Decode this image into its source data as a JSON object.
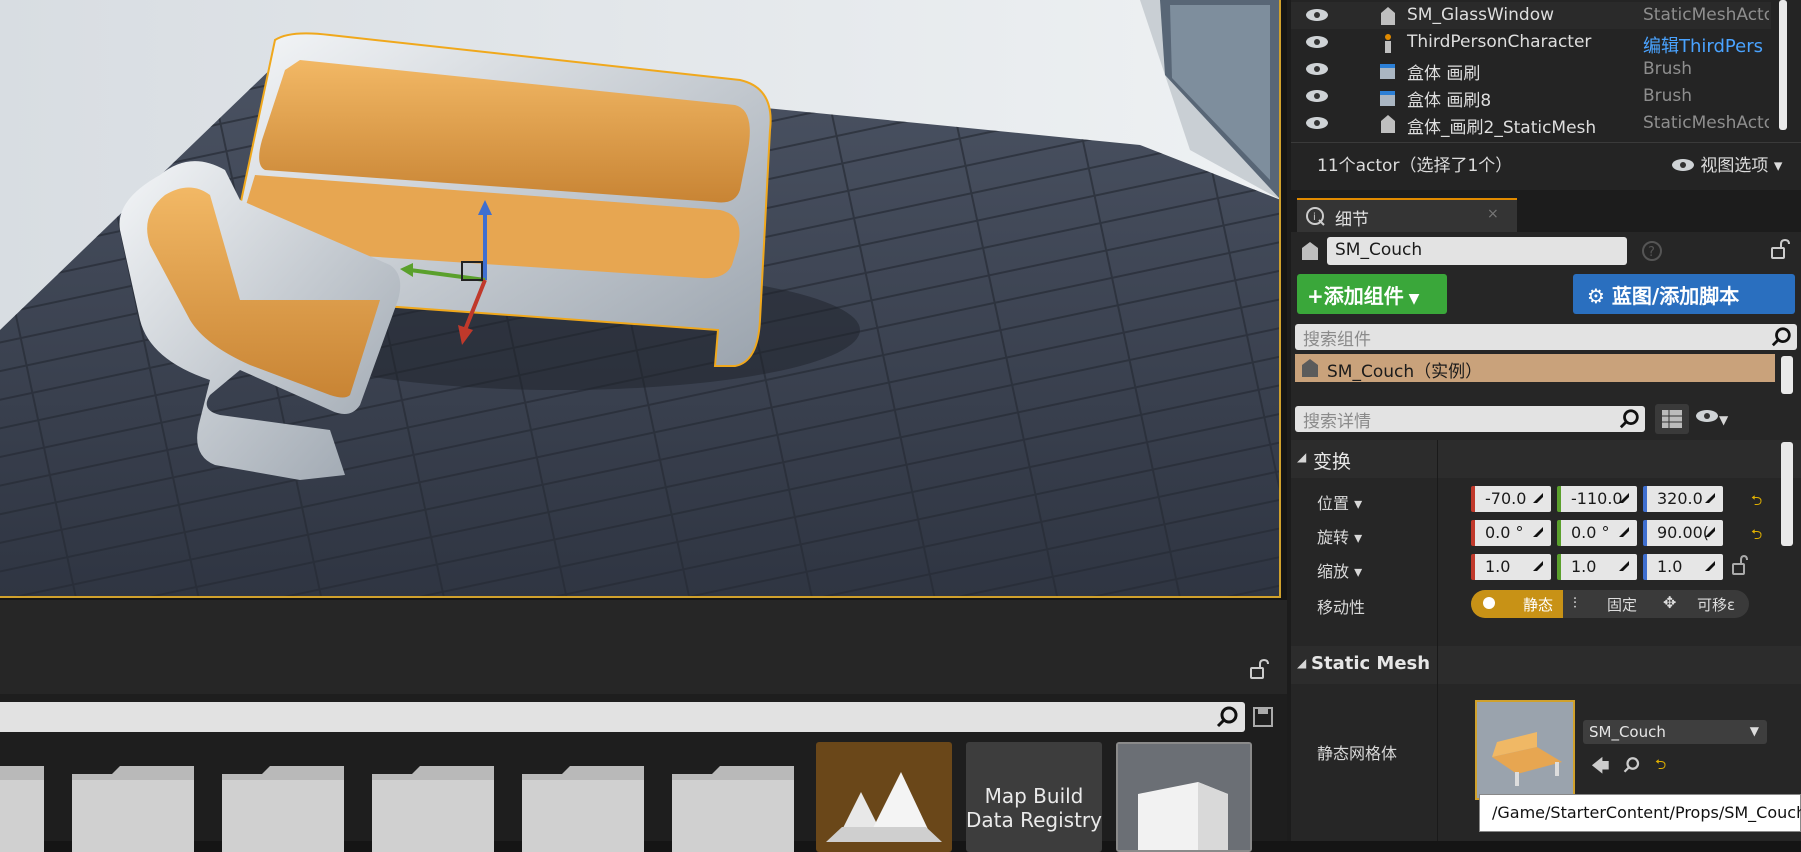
{
  "outliner": {
    "rows": [
      {
        "name": "SM_GlassWindow",
        "type": "StaticMeshActo"
      },
      {
        "name": "ThirdPersonCharacter",
        "type": "编辑ThirdPers"
      },
      {
        "name": "盒体 画刷",
        "type": "Brush"
      },
      {
        "name": "盒体 画刷8",
        "type": "Brush"
      },
      {
        "name": "盒体_画刷2_StaticMesh",
        "type": "StaticMeshActo"
      }
    ],
    "status": "11个actor（选择了1个）",
    "view_options": "视图选项"
  },
  "details": {
    "tab_label": "细节",
    "actor_name": "SM_Couch",
    "add_component": "添加组件",
    "blueprint_button": "蓝图/添加脚本",
    "search_components_placeholder": "搜索组件",
    "component_root": "SM_Couch（实例）",
    "search_details_placeholder": "搜索详情",
    "transform": {
      "header": "变换",
      "location_label": "位置",
      "location": [
        "-70.0",
        "-110.0",
        "320.0"
      ],
      "rotation_label": "旋转",
      "rotation": [
        "0.0 °",
        "0.0 °",
        "90.00("
      ],
      "scale_label": "缩放",
      "scale": [
        "1.0",
        "1.0",
        "1.0"
      ],
      "mobility_label": "移动性",
      "mobility": [
        "静态",
        "固定",
        "可移ε"
      ]
    },
    "static_mesh": {
      "header": "Static Mesh",
      "label": "静态网格体",
      "value": "SM_Couch",
      "tooltip": "/Game/StarterContent/Props/SM_Couch"
    }
  },
  "content_browser": {
    "assets": [
      {
        "label": ""
      },
      {
        "label": "Map Build\nData Registry"
      },
      {
        "label": ""
      }
    ]
  },
  "colors": {
    "accent_orange": "#e08a00",
    "selection_outline": "#f0a81c",
    "add_component_green": "#3aa73a",
    "blueprint_blue": "#2a6fbf",
    "x_red": "#c0392b",
    "y_green": "#5aa02c",
    "z_blue": "#3f6fd0",
    "mobility_static": "#c89216"
  }
}
